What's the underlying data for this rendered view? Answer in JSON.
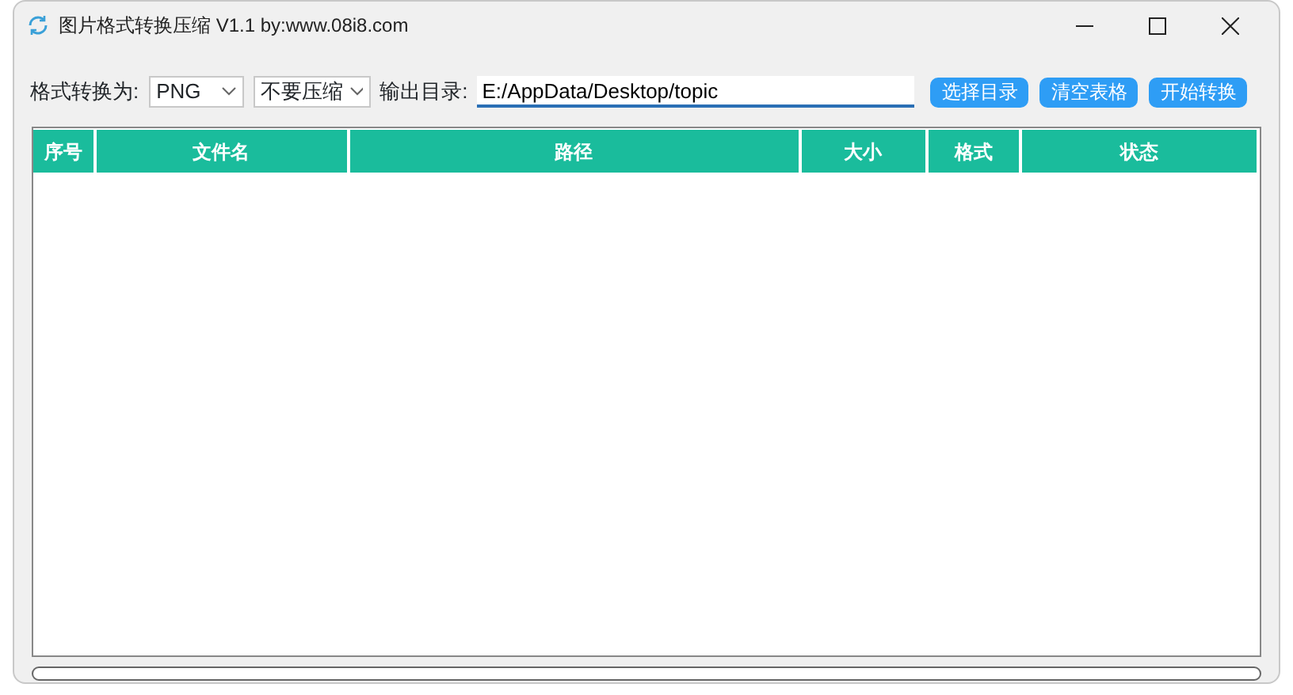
{
  "window": {
    "title": "图片格式转换压缩 V1.1 by:www.08i8.com"
  },
  "toolbar": {
    "format_label": "格式转换为:",
    "format_value": "PNG",
    "compress_value": "不要压缩",
    "output_label": "输出目录:",
    "output_dir": "E:/AppData/Desktop/topic",
    "buttons": [
      "选择目录",
      "清空表格",
      "开始转换"
    ]
  },
  "table": {
    "columns": [
      {
        "label": "序号"
      },
      {
        "label": "文件名"
      },
      {
        "label": "路径"
      },
      {
        "label": "大小"
      },
      {
        "label": "格式"
      },
      {
        "label": "状态"
      }
    ]
  },
  "progress": {
    "level": 0
  }
}
